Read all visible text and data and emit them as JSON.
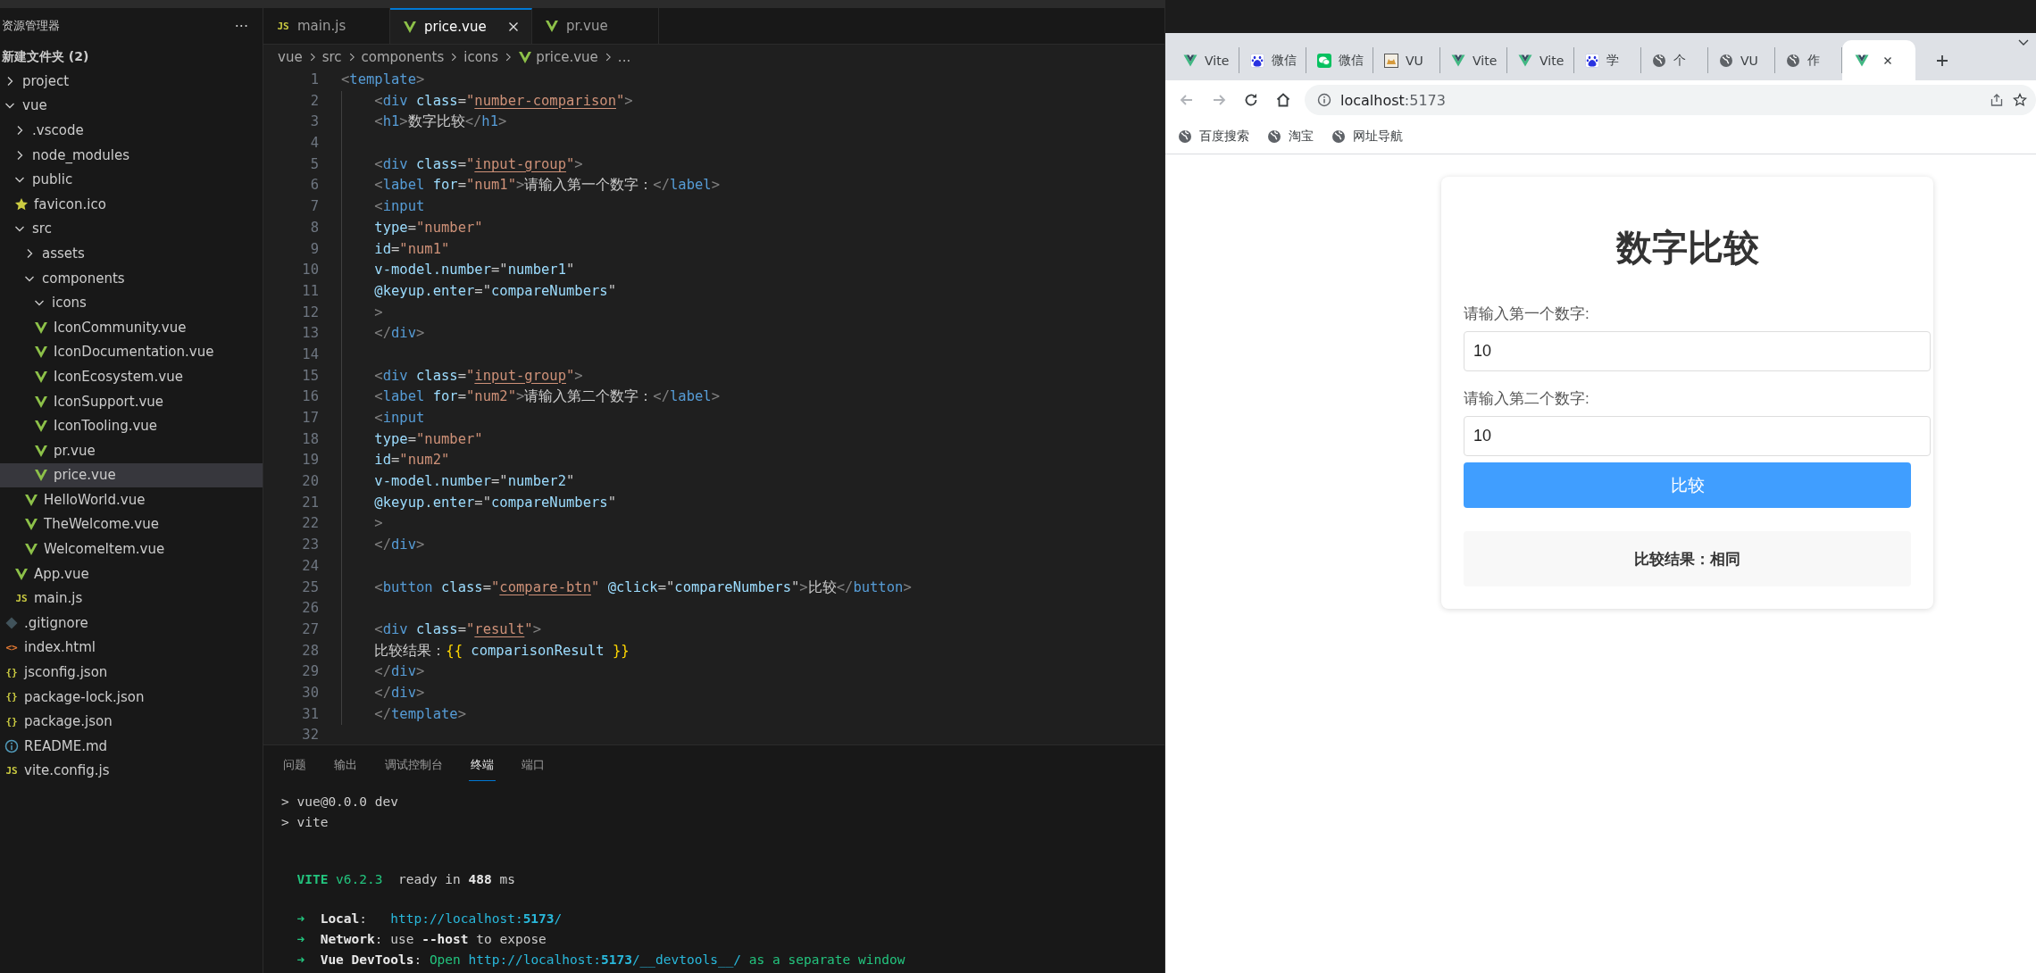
{
  "sidebar": {
    "title": "资源管理器",
    "more": "···",
    "folder_title": "新建文件夹 (2)",
    "tree": [
      {
        "name": "project",
        "kind": "folder",
        "expanded": false,
        "selected": false
      },
      {
        "name": "vue",
        "kind": "folder",
        "expanded": true,
        "selected": false,
        "children": [
          {
            "name": ".vscode",
            "kind": "folder",
            "expanded": false,
            "selected": false
          },
          {
            "name": "node_modules",
            "kind": "folder",
            "expanded": false,
            "selected": false
          },
          {
            "name": "public",
            "kind": "folder",
            "expanded": true,
            "selected": false,
            "children": [
              {
                "name": "favicon.ico",
                "kind": "star",
                "selected": false
              }
            ]
          },
          {
            "name": "src",
            "kind": "folder",
            "expanded": true,
            "selected": false,
            "children": [
              {
                "name": "assets",
                "kind": "folder",
                "expanded": false,
                "selected": false
              },
              {
                "name": "components",
                "kind": "folder",
                "expanded": true,
                "selected": false,
                "children": [
                  {
                    "name": "icons",
                    "kind": "folder",
                    "expanded": true,
                    "selected": false,
                    "children": [
                      {
                        "name": "IconCommunity.vue",
                        "kind": "vue",
                        "selected": false
                      },
                      {
                        "name": "IconDocumentation.vue",
                        "kind": "vue",
                        "selected": false
                      },
                      {
                        "name": "IconEcosystem.vue",
                        "kind": "vue",
                        "selected": false
                      },
                      {
                        "name": "IconSupport.vue",
                        "kind": "vue",
                        "selected": false
                      },
                      {
                        "name": "IconTooling.vue",
                        "kind": "vue",
                        "selected": false
                      },
                      {
                        "name": "pr.vue",
                        "kind": "vue",
                        "selected": false
                      },
                      {
                        "name": "price.vue",
                        "kind": "vue",
                        "selected": true
                      }
                    ]
                  },
                  {
                    "name": "HelloWorld.vue",
                    "kind": "vue",
                    "selected": false
                  },
                  {
                    "name": "TheWelcome.vue",
                    "kind": "vue",
                    "selected": false
                  },
                  {
                    "name": "WelcomeItem.vue",
                    "kind": "vue",
                    "selected": false
                  }
                ]
              },
              {
                "name": "App.vue",
                "kind": "vue",
                "selected": false
              },
              {
                "name": "main.js",
                "kind": "js",
                "badge": "JS",
                "selected": false
              }
            ]
          },
          {
            "name": ".gitignore",
            "kind": "git",
            "selected": false
          },
          {
            "name": "index.html",
            "kind": "html",
            "badge": "<>",
            "selected": false
          },
          {
            "name": "jsconfig.json",
            "kind": "json",
            "badge": "{}",
            "selected": false
          },
          {
            "name": "package-lock.json",
            "kind": "json",
            "badge": "{}",
            "selected": false
          },
          {
            "name": "package.json",
            "kind": "json",
            "badge": "{}",
            "selected": false
          },
          {
            "name": "README.md",
            "kind": "info",
            "selected": false
          },
          {
            "name": "vite.config.js",
            "kind": "js",
            "badge": "JS",
            "selected": false
          }
        ]
      }
    ]
  },
  "editor": {
    "tabs": [
      {
        "label": "main.js",
        "kind": "js",
        "badge": "JS",
        "selected": false
      },
      {
        "label": "price.vue",
        "kind": "vue",
        "selected": true
      },
      {
        "label": "pr.vue",
        "kind": "vue",
        "selected": false
      }
    ],
    "breadcrumb": [
      {
        "text": "vue"
      },
      {
        "text": "src"
      },
      {
        "text": "components"
      },
      {
        "text": "icons"
      },
      {
        "text": "price.vue",
        "kind": "vue"
      },
      {
        "text": "..."
      }
    ],
    "lines": [
      {
        "number": "1",
        "tokens": [
          {
            "kind": "punct",
            "text": "<"
          },
          {
            "kind": "tag",
            "text": "template"
          },
          {
            "kind": "punct",
            "text": ">"
          }
        ]
      },
      {
        "number": "2",
        "tokens": [
          {
            "kind": "punct",
            "text": "    <"
          },
          {
            "kind": "tag",
            "text": "div"
          },
          {
            "kind": "attr",
            "text": " class"
          },
          {
            "kind": "text",
            "text": "="
          },
          {
            "kind": "string",
            "text": "\""
          },
          {
            "kind": "underlined",
            "text": "number-comparison"
          },
          {
            "kind": "string",
            "text": "\""
          },
          {
            "kind": "punct",
            "text": ">"
          }
        ]
      },
      {
        "number": "3",
        "tokens": [
          {
            "kind": "punct",
            "text": "    <"
          },
          {
            "kind": "tag",
            "text": "h1"
          },
          {
            "kind": "punct",
            "text": ">"
          },
          {
            "kind": "text",
            "text": "数字比较"
          },
          {
            "kind": "punct",
            "text": "</"
          },
          {
            "kind": "tag",
            "text": "h1"
          },
          {
            "kind": "punct",
            "text": ">"
          }
        ]
      },
      {
        "number": "4"
      },
      {
        "number": "5",
        "tokens": [
          {
            "kind": "punct",
            "text": "    <"
          },
          {
            "kind": "tag",
            "text": "div"
          },
          {
            "kind": "attr",
            "text": " class"
          },
          {
            "kind": "text",
            "text": "="
          },
          {
            "kind": "string",
            "text": "\""
          },
          {
            "kind": "underlined",
            "text": "input-group"
          },
          {
            "kind": "string",
            "text": "\""
          },
          {
            "kind": "punct",
            "text": ">"
          }
        ]
      },
      {
        "number": "6",
        "tokens": [
          {
            "kind": "punct",
            "text": "    <"
          },
          {
            "kind": "tag",
            "text": "label"
          },
          {
            "kind": "attr",
            "text": " for"
          },
          {
            "kind": "text",
            "text": "="
          },
          {
            "kind": "string",
            "text": "\"num1\""
          },
          {
            "kind": "punct",
            "text": ">"
          },
          {
            "kind": "text",
            "text": "请输入第一个数字："
          },
          {
            "kind": "punct",
            "text": "</"
          },
          {
            "kind": "tag",
            "text": "label"
          },
          {
            "kind": "punct",
            "text": ">"
          }
        ]
      },
      {
        "number": "7",
        "tokens": [
          {
            "kind": "punct",
            "text": "    <"
          },
          {
            "kind": "tag",
            "text": "input"
          }
        ]
      },
      {
        "number": "8",
        "tokens": [
          {
            "kind": "attr",
            "text": "    type"
          },
          {
            "kind": "text",
            "text": "="
          },
          {
            "kind": "string",
            "text": "\"number\""
          }
        ]
      },
      {
        "number": "9",
        "tokens": [
          {
            "kind": "attr",
            "text": "    id"
          },
          {
            "kind": "text",
            "text": "="
          },
          {
            "kind": "string",
            "text": "\"num1\""
          }
        ]
      },
      {
        "number": "10",
        "tokens": [
          {
            "kind": "attr",
            "text": "    v-model.number"
          },
          {
            "kind": "text",
            "text": "=\""
          },
          {
            "kind": "expr",
            "text": "number1"
          },
          {
            "kind": "text",
            "text": "\""
          }
        ]
      },
      {
        "number": "11",
        "tokens": [
          {
            "kind": "attr",
            "text": "    @keyup.enter"
          },
          {
            "kind": "text",
            "text": "=\""
          },
          {
            "kind": "expr",
            "text": "compareNumbers"
          },
          {
            "kind": "text",
            "text": "\""
          }
        ]
      },
      {
        "number": "12",
        "tokens": [
          {
            "kind": "punct",
            "text": "    >"
          }
        ]
      },
      {
        "number": "13",
        "tokens": [
          {
            "kind": "punct",
            "text": "    </"
          },
          {
            "kind": "tag",
            "text": "div"
          },
          {
            "kind": "punct",
            "text": ">"
          }
        ]
      },
      {
        "number": "14"
      },
      {
        "number": "15",
        "tokens": [
          {
            "kind": "punct",
            "text": "    <"
          },
          {
            "kind": "tag",
            "text": "div"
          },
          {
            "kind": "attr",
            "text": " class"
          },
          {
            "kind": "text",
            "text": "="
          },
          {
            "kind": "string",
            "text": "\""
          },
          {
            "kind": "underlined",
            "text": "input-group"
          },
          {
            "kind": "string",
            "text": "\""
          },
          {
            "kind": "punct",
            "text": ">"
          }
        ]
      },
      {
        "number": "16",
        "tokens": [
          {
            "kind": "punct",
            "text": "    <"
          },
          {
            "kind": "tag",
            "text": "label"
          },
          {
            "kind": "attr",
            "text": " for"
          },
          {
            "kind": "text",
            "text": "="
          },
          {
            "kind": "string",
            "text": "\"num2\""
          },
          {
            "kind": "punct",
            "text": ">"
          },
          {
            "kind": "text",
            "text": "请输入第二个数字："
          },
          {
            "kind": "punct",
            "text": "</"
          },
          {
            "kind": "tag",
            "text": "label"
          },
          {
            "kind": "punct",
            "text": ">"
          }
        ]
      },
      {
        "number": "17",
        "tokens": [
          {
            "kind": "punct",
            "text": "    <"
          },
          {
            "kind": "tag",
            "text": "input"
          }
        ]
      },
      {
        "number": "18",
        "tokens": [
          {
            "kind": "attr",
            "text": "    type"
          },
          {
            "kind": "text",
            "text": "="
          },
          {
            "kind": "string",
            "text": "\"number\""
          }
        ]
      },
      {
        "number": "19",
        "tokens": [
          {
            "kind": "attr",
            "text": "    id"
          },
          {
            "kind": "text",
            "text": "="
          },
          {
            "kind": "string",
            "text": "\"num2\""
          }
        ]
      },
      {
        "number": "20",
        "tokens": [
          {
            "kind": "attr",
            "text": "    v-model.number"
          },
          {
            "kind": "text",
            "text": "=\""
          },
          {
            "kind": "expr",
            "text": "number2"
          },
          {
            "kind": "text",
            "text": "\""
          }
        ]
      },
      {
        "number": "21",
        "tokens": [
          {
            "kind": "attr",
            "text": "    @keyup.enter"
          },
          {
            "kind": "text",
            "text": "=\""
          },
          {
            "kind": "expr",
            "text": "compareNumbers"
          },
          {
            "kind": "text",
            "text": "\""
          }
        ]
      },
      {
        "number": "22",
        "tokens": [
          {
            "kind": "punct",
            "text": "    >"
          }
        ]
      },
      {
        "number": "23",
        "tokens": [
          {
            "kind": "punct",
            "text": "    </"
          },
          {
            "kind": "tag",
            "text": "div"
          },
          {
            "kind": "punct",
            "text": ">"
          }
        ]
      },
      {
        "number": "24"
      },
      {
        "number": "25",
        "tokens": [
          {
            "kind": "punct",
            "text": "    <"
          },
          {
            "kind": "tag",
            "text": "button"
          },
          {
            "kind": "attr",
            "text": " class"
          },
          {
            "kind": "text",
            "text": "="
          },
          {
            "kind": "string",
            "text": "\""
          },
          {
            "kind": "underlined",
            "text": "compare-btn"
          },
          {
            "kind": "string",
            "text": "\""
          },
          {
            "kind": "attr",
            "text": " @click"
          },
          {
            "kind": "text",
            "text": "=\""
          },
          {
            "kind": "expr",
            "text": "compareNumbers"
          },
          {
            "kind": "text",
            "text": "\""
          },
          {
            "kind": "punct",
            "text": ">"
          },
          {
            "kind": "text",
            "text": "比较"
          },
          {
            "kind": "punct",
            "text": "</"
          },
          {
            "kind": "tag",
            "text": "button"
          },
          {
            "kind": "punct",
            "text": ">"
          }
        ]
      },
      {
        "number": "26"
      },
      {
        "number": "27",
        "tokens": [
          {
            "kind": "punct",
            "text": "    <"
          },
          {
            "kind": "tag",
            "text": "div"
          },
          {
            "kind": "attr",
            "text": " class"
          },
          {
            "kind": "text",
            "text": "="
          },
          {
            "kind": "string",
            "text": "\""
          },
          {
            "kind": "underlined",
            "text": "result"
          },
          {
            "kind": "string",
            "text": "\""
          },
          {
            "kind": "punct",
            "text": ">"
          }
        ]
      },
      {
        "number": "28",
        "tokens": [
          {
            "kind": "text",
            "text": "    比较结果："
          },
          {
            "kind": "brace",
            "text": "{{"
          },
          {
            "kind": "expr",
            "text": " comparisonResult "
          },
          {
            "kind": "brace",
            "text": "}}"
          }
        ]
      },
      {
        "number": "29",
        "tokens": [
          {
            "kind": "punct",
            "text": "    </"
          },
          {
            "kind": "tag",
            "text": "div"
          },
          {
            "kind": "punct",
            "text": ">"
          }
        ]
      },
      {
        "number": "30",
        "tokens": [
          {
            "kind": "punct",
            "text": "    </"
          },
          {
            "kind": "tag",
            "text": "div"
          },
          {
            "kind": "punct",
            "text": ">"
          }
        ]
      },
      {
        "number": "31",
        "tokens": [
          {
            "kind": "punct",
            "text": "    </"
          },
          {
            "kind": "tag",
            "text": "template"
          },
          {
            "kind": "punct",
            "text": ">"
          }
        ]
      },
      {
        "number": "32"
      }
    ]
  },
  "panel": {
    "tabs": [
      {
        "label": "问题",
        "selected": false
      },
      {
        "label": "输出",
        "selected": false
      },
      {
        "label": "调试控制台",
        "selected": false
      },
      {
        "label": "终端",
        "selected": true
      },
      {
        "label": "端口",
        "selected": false
      }
    ],
    "terminal": [
      [
        [
          {
            "kind": "plain",
            "text": "> vue@0.0.0 dev"
          }
        ],
        [
          {
            "kind": "plain",
            "text": "> vite"
          }
        ]
      ],
      [
        [
          {
            "kind": "greenbold",
            "text": "  VITE"
          },
          {
            "kind": "green",
            "text": " v6.2.3"
          },
          {
            "kind": "plain",
            "text": "  ready in "
          },
          {
            "kind": "bold",
            "text": "488"
          },
          {
            "kind": "plain",
            "text": " ms"
          }
        ]
      ],
      [
        [
          {
            "kind": "green",
            "text": "  ➜  "
          },
          {
            "kind": "bold",
            "text": "Local"
          },
          {
            "kind": "plain",
            "text": ":   "
          },
          {
            "kind": "link",
            "text": "http://localhost:"
          },
          {
            "kind": "linkbold",
            "text": "5173"
          },
          {
            "kind": "link",
            "text": "/"
          }
        ],
        [
          {
            "kind": "green",
            "text": "  ➜  "
          },
          {
            "kind": "bold",
            "text": "Network"
          },
          {
            "kind": "plain",
            "text": ": use "
          },
          {
            "kind": "bold",
            "text": "--host"
          },
          {
            "kind": "plain",
            "text": " to expose"
          }
        ],
        [
          {
            "kind": "green",
            "text": "  ➜  "
          },
          {
            "kind": "bold",
            "text": "Vue DevTools"
          },
          {
            "kind": "plain",
            "text": ": "
          },
          {
            "kind": "green",
            "text": "Open "
          },
          {
            "kind": "link",
            "text": "http://localhost:"
          },
          {
            "kind": "linkbold",
            "text": "5173"
          },
          {
            "kind": "link",
            "text": "/__devtools__/"
          },
          {
            "kind": "green",
            "text": " as a separate window"
          }
        ]
      ]
    ]
  },
  "browser": {
    "tabs": [
      {
        "kind": "vue",
        "title": "Vite",
        "selected": false
      },
      {
        "kind": "paw",
        "title": "微信",
        "selected": false
      },
      {
        "kind": "chat",
        "title": "微信",
        "selected": false
      },
      {
        "kind": "cat",
        "title": "VU",
        "selected": false
      },
      {
        "kind": "vue",
        "title": "Vite",
        "selected": false
      },
      {
        "kind": "vue",
        "title": "Vite",
        "selected": false
      },
      {
        "kind": "paw",
        "title": "学",
        "selected": false
      },
      {
        "kind": "globe",
        "title": "个",
        "selected": false
      },
      {
        "kind": "globe",
        "title": "VU",
        "selected": false
      },
      {
        "kind": "globe",
        "title": "作",
        "selected": false
      },
      {
        "kind": "vue",
        "selected": true
      }
    ],
    "url_host": "localhost",
    "url_port": ":5173",
    "bookmarks": [
      {
        "label": "百度搜索"
      },
      {
        "label": "淘宝"
      },
      {
        "label": "网址导航"
      }
    ],
    "page": {
      "title": "数字比较",
      "fields": [
        {
          "label": "请输入第一个数字:",
          "value": "10"
        },
        {
          "label": "请输入第二个数字:",
          "value": "10"
        }
      ],
      "button": "比较",
      "result": "比较结果：相同"
    }
  }
}
